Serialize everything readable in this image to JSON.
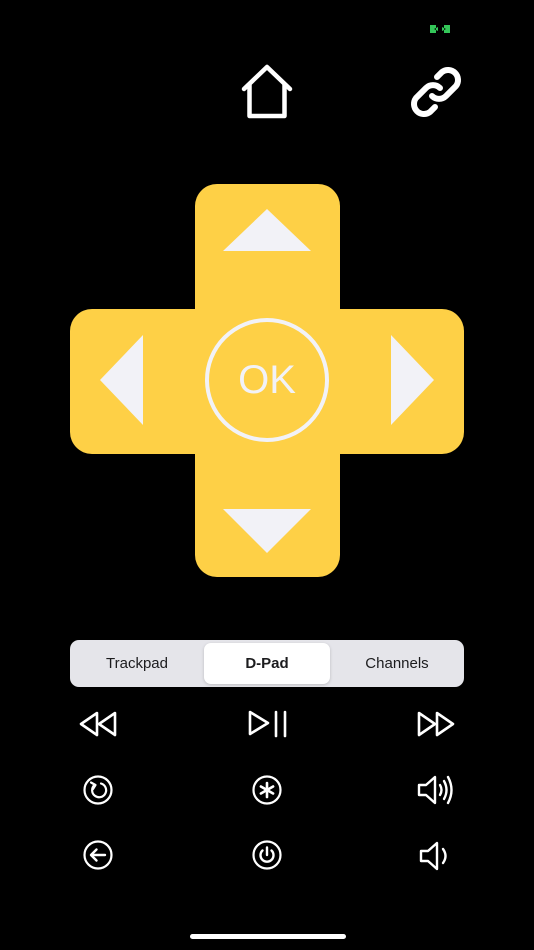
{
  "status": {
    "indicator_icon": "connection-indicator-icon",
    "indicator_color": "#34c759"
  },
  "header": {
    "home_icon": "home-icon",
    "link_icon": "link-icon"
  },
  "dpad": {
    "color": "#fed046",
    "ok_label": "OK",
    "up_icon": "arrow-up-icon",
    "down_icon": "arrow-down-icon",
    "left_icon": "arrow-left-icon",
    "right_icon": "arrow-right-icon"
  },
  "mode_selector": {
    "tabs": [
      {
        "label": "Trackpad",
        "selected": false
      },
      {
        "label": "D-Pad",
        "selected": true
      },
      {
        "label": "Channels",
        "selected": false
      }
    ]
  },
  "controls": {
    "row1": [
      "rewind-icon",
      "play-pause-icon",
      "fast-forward-icon"
    ],
    "row2": [
      "instant-replay-icon",
      "options-asterisk-icon",
      "volume-up-icon"
    ],
    "row3": [
      "back-icon",
      "power-icon",
      "volume-down-icon"
    ]
  }
}
